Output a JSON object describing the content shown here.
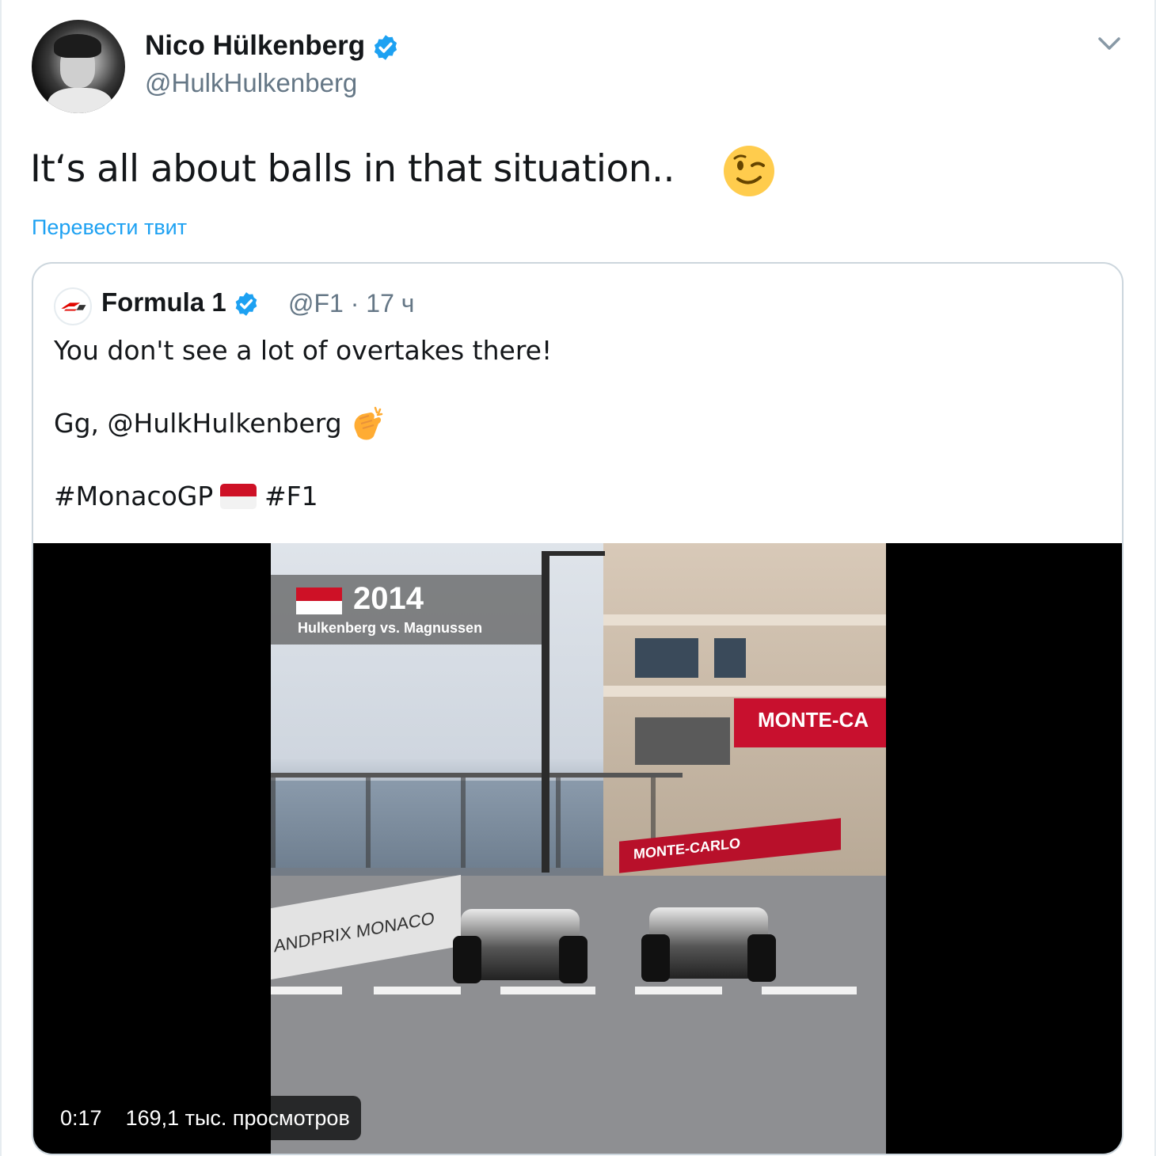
{
  "tweet": {
    "author_name": "Nico Hülkenberg",
    "author_handle": "@HulkHulkenberg",
    "text": "It‘s all about balls in that situation..",
    "emoji": "winking-face-emoji",
    "translate_label": "Перевести твит"
  },
  "quoted": {
    "author_name": "Formula 1",
    "handle_time": "@F1 · 17 ч",
    "line1": "You don't see a lot of overtakes there!",
    "line2": "Gg, @HulkHulkenberg",
    "line3_hashtag1": "#MonacoGP",
    "line3_hashtag2": "#F1",
    "emoji_clap": "clapping-hands-emoji",
    "flag": "monaco-flag"
  },
  "video": {
    "overlay_year": "2014",
    "overlay_subtitle": "Hulkenberg vs. Magnussen",
    "banner_text": "MONTE-CA",
    "barrier_text": "MONTE-CARLO",
    "left_barrier_text": "ANDPRIX MONACO",
    "duration": "0:17",
    "views": "169,1 тыс. просмотров"
  },
  "colors": {
    "link": "#1da1f2",
    "verified": "#1da1f2",
    "secondary_text": "#657786",
    "border": "#ccd6dd"
  }
}
